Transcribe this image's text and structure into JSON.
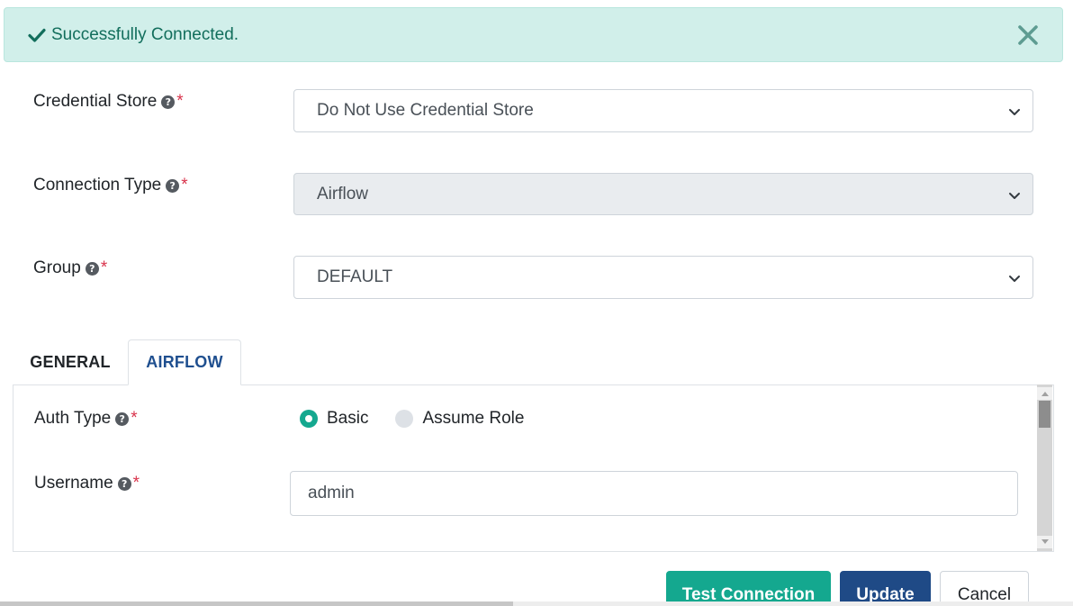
{
  "alert": {
    "message": "Successfully Connected.",
    "icon": "check-icon",
    "close_icon": "close-icon",
    "text_color": "#126e5c",
    "background": "#d1efea"
  },
  "fields": {
    "credential_store": {
      "label": "Credential Store",
      "required": "*",
      "value": "Do Not Use Credential Store"
    },
    "connection_type": {
      "label": "Connection Type",
      "required": "*",
      "value": "Airflow"
    },
    "group": {
      "label": "Group",
      "required": "*",
      "value": "DEFAULT"
    }
  },
  "tabs": [
    {
      "label": "GENERAL",
      "active": false
    },
    {
      "label": "AIRFLOW",
      "active": true
    }
  ],
  "airflow_panel": {
    "auth_type": {
      "label": "Auth Type",
      "required": "*",
      "options": [
        {
          "label": "Basic",
          "selected": true
        },
        {
          "label": "Assume Role",
          "selected": false
        }
      ]
    },
    "username": {
      "label": "Username",
      "required": "*",
      "value": "admin"
    }
  },
  "buttons": {
    "test_connection": "Test Connection",
    "update": "Update",
    "cancel": "Cancel"
  },
  "colors": {
    "accent": "#14a88f",
    "primary": "#1f4a86",
    "required": "#d9344c",
    "active_tab": "#1f4f8f"
  }
}
